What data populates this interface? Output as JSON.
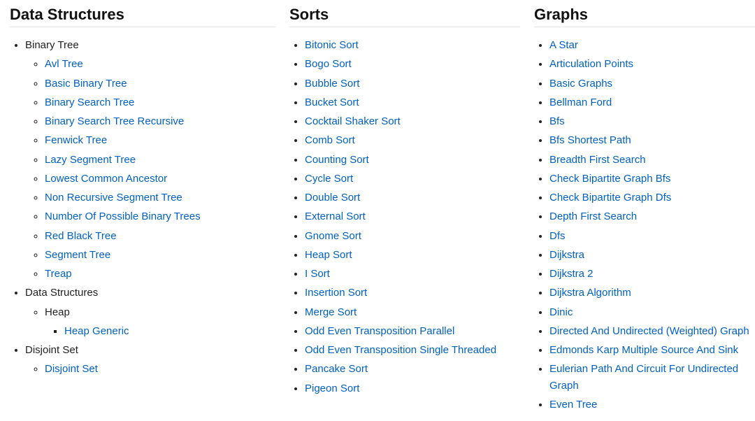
{
  "columns": {
    "data_structures": {
      "title": "Data Structures",
      "groups": [
        {
          "label": "Binary Tree",
          "link": false,
          "children": [
            {
              "label": "Avl Tree",
              "link": true
            },
            {
              "label": "Basic Binary Tree",
              "link": true
            },
            {
              "label": "Binary Search Tree",
              "link": true
            },
            {
              "label": "Binary Search Tree Recursive",
              "link": true
            },
            {
              "label": "Fenwick Tree",
              "link": true
            },
            {
              "label": "Lazy Segment Tree",
              "link": true
            },
            {
              "label": "Lowest Common Ancestor",
              "link": true
            },
            {
              "label": "Non Recursive Segment Tree",
              "link": true
            },
            {
              "label": "Number Of Possible Binary Trees",
              "link": true
            },
            {
              "label": "Red Black Tree",
              "link": true
            },
            {
              "label": "Segment Tree",
              "link": true
            },
            {
              "label": "Treap",
              "link": true
            }
          ]
        },
        {
          "label": "Data Structures",
          "link": false,
          "children": [
            {
              "label": "Heap",
              "link": false,
              "children": [
                {
                  "label": "Heap Generic",
                  "link": true
                }
              ]
            }
          ]
        },
        {
          "label": "Disjoint Set",
          "link": false,
          "children": [
            {
              "label": "Disjoint Set",
              "link": true
            }
          ]
        }
      ]
    },
    "sorts": {
      "title": "Sorts",
      "items": [
        "Bitonic Sort",
        "Bogo Sort",
        "Bubble Sort",
        "Bucket Sort",
        "Cocktail Shaker Sort",
        "Comb Sort",
        "Counting Sort",
        "Cycle Sort",
        "Double Sort",
        "External Sort",
        "Gnome Sort",
        "Heap Sort",
        "I Sort",
        "Insertion Sort",
        "Merge Sort",
        "Odd Even Transposition Parallel",
        "Odd Even Transposition Single Threaded",
        "Pancake Sort",
        "Pigeon Sort"
      ]
    },
    "graphs": {
      "title": "Graphs",
      "items": [
        "A Star",
        "Articulation Points",
        "Basic Graphs",
        "Bellman Ford",
        "Bfs",
        "Bfs Shortest Path",
        "Breadth First Search",
        "Check Bipartite Graph Bfs",
        "Check Bipartite Graph Dfs",
        "Depth First Search",
        "Dfs",
        "Dijkstra",
        "Dijkstra 2",
        "Dijkstra Algorithm",
        "Dinic",
        "Directed And Undirected (Weighted) Graph",
        "Edmonds Karp Multiple Source And Sink",
        "Eulerian Path And Circuit For Undirected Graph",
        "Even Tree"
      ]
    }
  }
}
